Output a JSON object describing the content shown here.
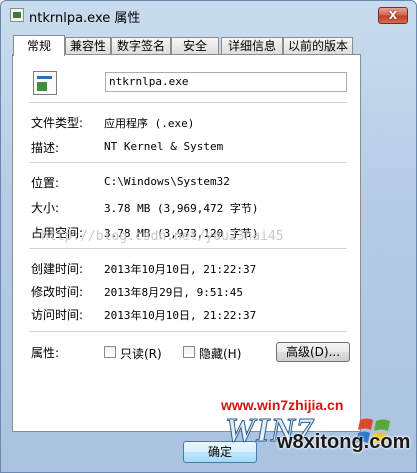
{
  "window": {
    "title": "ntkrnlpa.exe 属性",
    "close_glyph": "X"
  },
  "tabs": [
    {
      "label": "常规",
      "active": true
    },
    {
      "label": "兼容性"
    },
    {
      "label": "数字签名"
    },
    {
      "label": "安全"
    },
    {
      "label": "详细信息"
    },
    {
      "label": "以前的版本"
    }
  ],
  "general": {
    "file_name": "ntkrnlpa.exe",
    "rows": [
      {
        "label": "文件类型:",
        "value": "应用程序 (.exe)"
      },
      {
        "label": "描述:",
        "value": "NT Kernel & System"
      },
      {
        "label": "位置:",
        "value": "C:\\Windows\\System32"
      },
      {
        "label": "大小:",
        "value": "3.78 MB (3,969,472 字节)"
      },
      {
        "label": "占用空间:",
        "value": "3.78 MB (3,973,120 字节)"
      },
      {
        "label": "创建时间:",
        "value": "2013年10月10日, 21:22:37"
      },
      {
        "label": "修改时间:",
        "value": "2013年8月29日, 9:51:45"
      },
      {
        "label": "访问时间:",
        "value": "2013年10月10日, 21:22:37"
      }
    ],
    "attributes_label": "属性:",
    "readonly": {
      "label": "只读(R)",
      "checked": false
    },
    "hidden": {
      "label": "隐藏(H)",
      "checked": false
    },
    "advanced_label": "高级(D)..."
  },
  "watermark": "http://blog.csdn.net/you23hai45",
  "buttons": {
    "ok": "确定"
  },
  "branding": {
    "url": "www.win7zhijia.cn",
    "logo_text": "WIN7",
    "site": "w8xitong.com",
    "url_color": "#d21414"
  }
}
